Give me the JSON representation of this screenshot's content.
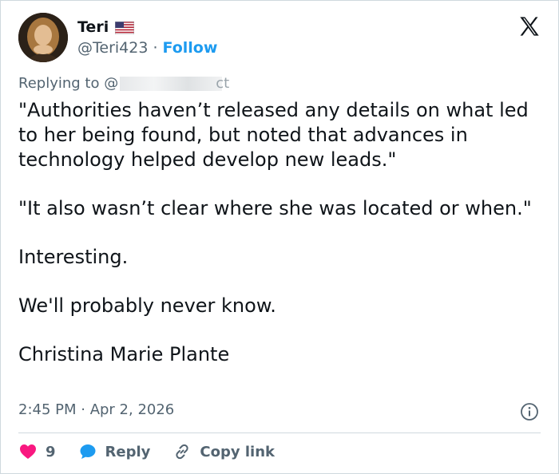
{
  "author": {
    "display_name": "Teri",
    "flag": "us-flag-icon",
    "handle": "@Teri423",
    "separator": "·",
    "follow_label": "Follow"
  },
  "reply": {
    "prefix": "Replying to @",
    "redacted_tail": "ct"
  },
  "tweet": {
    "paragraphs": [
      "\"Authorities haven’t released any details on what led to her being found, but noted that advances in technology helped develop new leads.\"",
      "\"It also wasn’t clear where she was located or when.\"",
      "Interesting.",
      "We'll probably never know.",
      "Christina Marie Plante"
    ],
    "timestamp": "2:45 PM · Apr 2, 2026"
  },
  "actions": {
    "like_count": "9",
    "reply_label": "Reply",
    "copy_label": "Copy link"
  },
  "colors": {
    "accent": "#1d9bf0",
    "like": "#f91880",
    "muted": "#536471",
    "text": "#0f1419"
  }
}
